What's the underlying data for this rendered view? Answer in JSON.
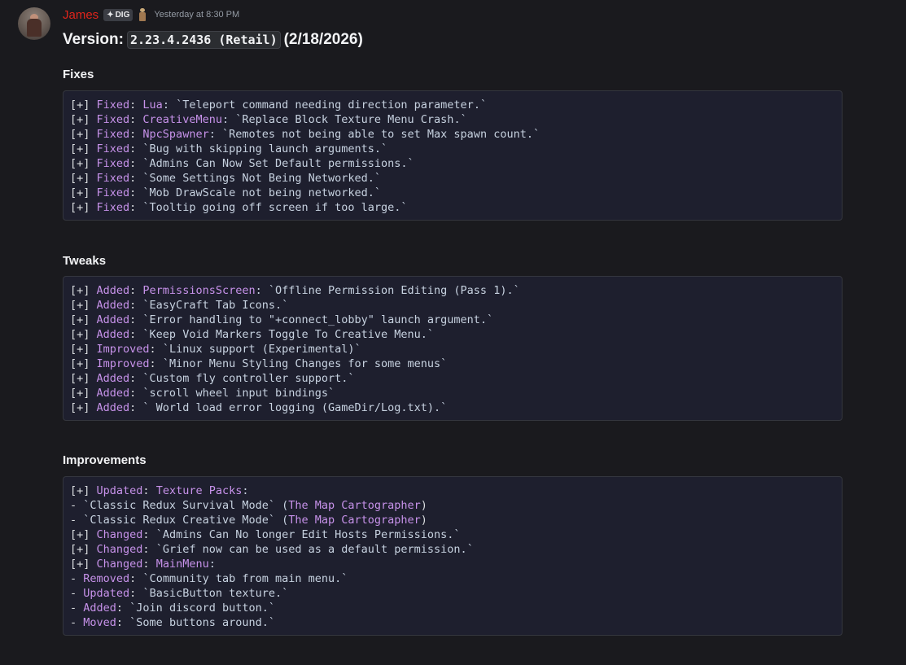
{
  "message": {
    "author": "James",
    "tag": "DIG",
    "timestamp": "Yesterday at 8:30 PM",
    "icons": {
      "tag": "diamond-shield-icon",
      "role": "figure-icon",
      "avatar": "user-avatar"
    },
    "colors": {
      "username": "#e0241b",
      "keyword": "#c792ea",
      "text": "#dbdee1",
      "background": "#1a1a1e",
      "codeblock": "#1e1f2e"
    }
  },
  "version": {
    "prefix": "Version:",
    "code": "2.23.4.2436 (Retail)",
    "date": "(2/18/2026)"
  },
  "sections": [
    {
      "title": "Fixes",
      "lines": [
        [
          "[+] ",
          "Fixed",
          ": ",
          "Lua",
          ": `Teleport command needing direction parameter.`"
        ],
        [
          "[+] ",
          "Fixed",
          ": ",
          "CreativeMenu",
          ": `Replace Block Texture Menu Crash.`"
        ],
        [
          "[+] ",
          "Fixed",
          ": ",
          "NpcSpawner",
          ": `Remotes not being able to set Max spawn count.`"
        ],
        [
          "[+] ",
          "Fixed",
          ": ",
          "",
          "`Bug with skipping launch arguments.`"
        ],
        [
          "[+] ",
          "Fixed",
          ": ",
          "",
          "`Admins Can Now Set Default permissions.`"
        ],
        [
          "[+] ",
          "Fixed",
          ": ",
          "",
          "`Some Settings Not Being Networked.`"
        ],
        [
          "[+] ",
          "Fixed",
          ": ",
          "",
          "`Mob DrawScale not being networked.`"
        ],
        [
          "[+] ",
          "Fixed",
          ": ",
          "",
          "`Tooltip going off screen if too large.`"
        ]
      ]
    },
    {
      "title": "Tweaks",
      "lines": [
        [
          "[+] ",
          "Added",
          ": ",
          "PermissionsScreen",
          ": `Offline Permission Editing (Pass 1).`"
        ],
        [
          "[+] ",
          "Added",
          ": ",
          "",
          "`EasyCraft Tab Icons.`"
        ],
        [
          "[+] ",
          "Added",
          ": ",
          "",
          "`Error handling to \"+connect_lobby\" launch argument.`"
        ],
        [
          "[+] ",
          "Added",
          ": ",
          "",
          "`Keep Void Markers Toggle To Creative Menu.`"
        ],
        [
          "[+] ",
          "Improved",
          ": ",
          "",
          "`Linux support (Experimental)`"
        ],
        [
          "[+] ",
          "Improved",
          ": ",
          "",
          "`Minor Menu Styling Changes for some menus`"
        ],
        [
          "[+] ",
          "Added",
          ": ",
          "",
          "`Custom fly controller support.`"
        ],
        [
          "[+] ",
          "Added",
          ": ",
          "",
          "`scroll wheel input bindings`"
        ],
        [
          "[+] ",
          "Added",
          ": ",
          "",
          "` World load error logging (GameDir/Log.txt).`"
        ]
      ]
    },
    {
      "title": "Improvements",
      "lines": [
        [
          "[+] ",
          "Updated",
          ": ",
          "Texture Packs",
          ":"
        ],
        [
          "- ",
          "",
          "",
          "",
          "`Classic Redux Survival Mode` (",
          "The Map Cartographer",
          ")"
        ],
        [
          "- ",
          "",
          "",
          "",
          "`Classic Redux Creative Mode` (",
          "The Map Cartographer",
          ")"
        ],
        [
          "[+] ",
          "Changed",
          ": ",
          "",
          "`Admins Can No longer Edit Hosts Permissions.`"
        ],
        [
          "[+] ",
          "Changed",
          ": ",
          "",
          "`Grief now can be used as a default permission.`"
        ],
        [
          "[+] ",
          "Changed",
          ": ",
          "MainMenu",
          ":"
        ],
        [
          "- ",
          "Removed",
          ": ",
          "",
          "`Community tab from main menu.`"
        ],
        [
          "- ",
          "Updated",
          ": ",
          "",
          "`BasicButton texture.`"
        ],
        [
          "- ",
          "Added",
          ": ",
          "",
          "`Join discord button.`"
        ],
        [
          "- ",
          "Moved",
          ": ",
          "",
          "`Some buttons around.`"
        ]
      ]
    }
  ]
}
